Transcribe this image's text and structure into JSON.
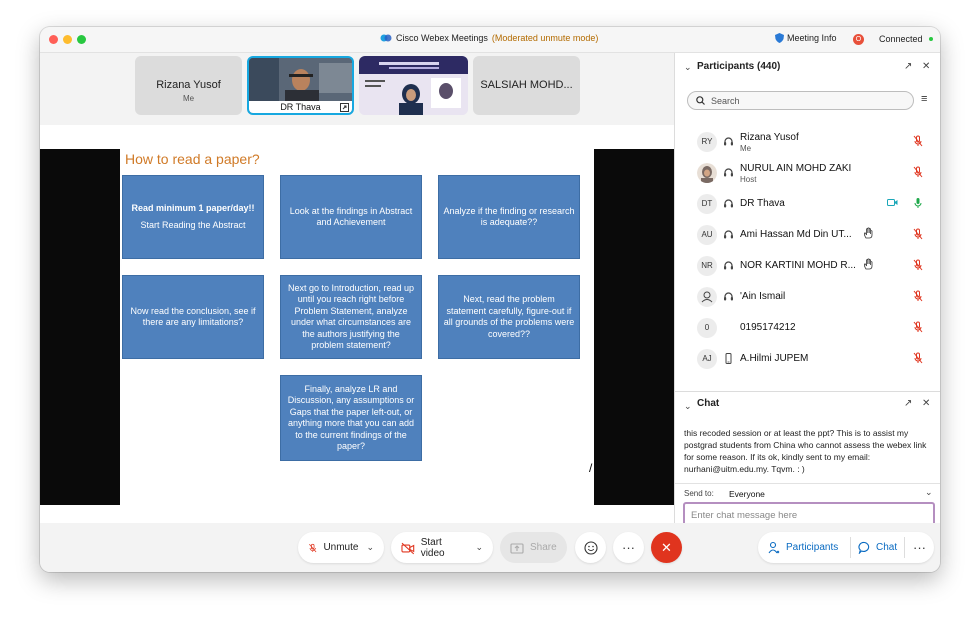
{
  "window": {
    "app_name": "Cisco Webex Meetings",
    "mode": "(Moderated unmute mode)",
    "meeting_info": "Meeting Info",
    "recording_badge": "O",
    "status": "Connected"
  },
  "thumbnails": [
    {
      "name": "Rizana Yusof",
      "sub": "Me"
    },
    {
      "name": "DR Thava"
    },
    {
      "name": ""
    },
    {
      "name": "SALSIAH MOHD..."
    }
  ],
  "slide": {
    "title": "How to read a paper?",
    "boxes": [
      {
        "bold": "Read minimum 1 paper/day!!",
        "text": "Start Reading the Abstract"
      },
      {
        "text": "Look at the findings in Abstract and Achievement"
      },
      {
        "text": "Analyze if the finding or research is adequate??"
      },
      {
        "text": "Now read the conclusion, see if there are any limitations?"
      },
      {
        "text": "Next go to Introduction, read up until you reach right before Problem Statement, analyze under what circumstances are the authors justifying the problem statement?"
      },
      {
        "text": "Next, read the problem statement carefully, figure-out if all grounds of the problems were covered??"
      },
      {
        "text": "Finally, analyze LR and Discussion, any assumptions or Gaps that the paper left-out, or anything more that you can add to the current findings of the paper?"
      }
    ],
    "stray_mark": "/"
  },
  "controls": {
    "unmute": "Unmute",
    "start_video": "Start video",
    "share": "Share",
    "participants": "Participants",
    "chat": "Chat"
  },
  "participants_panel": {
    "title": "Participants (440)",
    "search_placeholder": "Search",
    "rows": [
      {
        "initials": "RY",
        "name": "Rizana Yusof",
        "sub": "Me",
        "mic": "muted"
      },
      {
        "initials": "",
        "name": "NURUL AIN MOHD ZAKI",
        "sub": "Host",
        "mic": "muted"
      },
      {
        "initials": "DT",
        "name": "DR Thava",
        "sub": "",
        "mic": "on",
        "video": true
      },
      {
        "initials": "AU",
        "name": "Ami Hassan Md Din UT...",
        "sub": "",
        "mic": "muted",
        "hand": true
      },
      {
        "initials": "NR",
        "name": "NOR KARTINI MOHD R...",
        "sub": "",
        "mic": "muted",
        "hand": true
      },
      {
        "initials": "",
        "name": "'Ain Ismail",
        "sub": "",
        "mic": "muted"
      },
      {
        "initials": "0",
        "name": "0195174212",
        "sub": "",
        "mic": "muted"
      },
      {
        "initials": "AJ",
        "name": "A.Hilmi JUPEM",
        "sub": "",
        "mic": "muted"
      }
    ]
  },
  "chat_panel": {
    "title": "Chat",
    "message": "this recoded session or at least the ppt? This is to assist my postgrad students from China who cannot assess the webex link for some reason. If its ok, kindly sent to my email: nurhani@uitm.edu.my. Tqvm. : )",
    "send_to_label": "Send to:",
    "send_to_value": "Everyone",
    "input_placeholder": "Enter chat message here"
  },
  "colors": {
    "slide_box": "#4f81bd",
    "slide_title": "#d07a27",
    "end_call": "#e0341e",
    "muted_mic": "#e0341e",
    "active_mic": "#1ea84a",
    "link_blue": "#0a6bc2"
  }
}
